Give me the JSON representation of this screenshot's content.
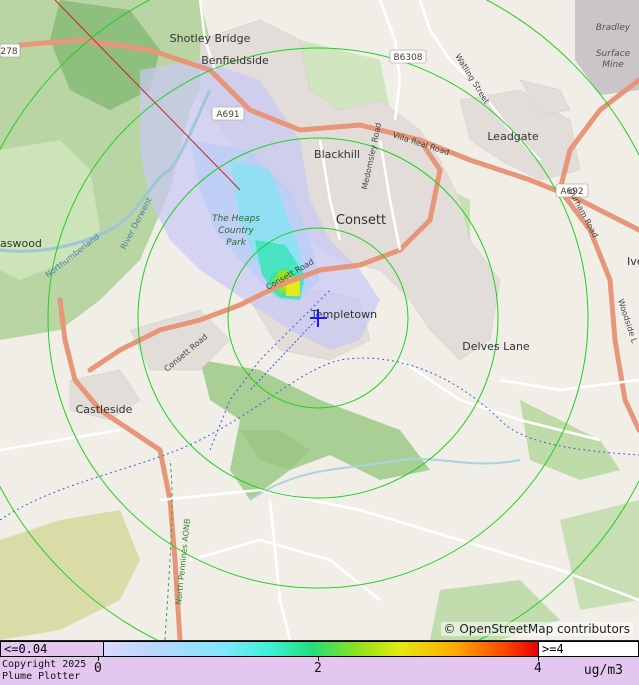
{
  "map": {
    "places": {
      "shotley_bridge": "Shotley Bridge",
      "benfieldside": "Benfieldside",
      "blackhill": "Blackhill",
      "consett": "Consett",
      "templetown": "Templetown",
      "delves_lane": "Delves Lane",
      "castleside": "Castleside",
      "leadgate": "Leadgate",
      "bradley_mine": [
        "Bradley",
        "Surface",
        "Mine"
      ],
      "iveston": "Ive",
      "laswood": "aswood",
      "heaps_park": [
        "The Heaps",
        "Country",
        "Park"
      ]
    },
    "roads": {
      "a691": "A691",
      "b6308": "B6308",
      "a692": "A692",
      "a68": "278",
      "villa_real_road": "Villa Real Road",
      "medomsley_road": "Medomsley Road",
      "consett_road": "Consett Road",
      "durham_road": "Durham Road",
      "watling_street": "Watling Street",
      "woodside": "Woodside L",
      "consett_road_2": "Consett Road"
    },
    "waterways": {
      "river_derwent": "River Derwent",
      "northumberland": "Northumberland"
    },
    "boundary_label": "North Pennines AONB",
    "attribution": "© OpenStreetMap contributors",
    "source_marker": "source-cross",
    "colors": {
      "ring": "#1ed11e",
      "cross": "#1a1aff",
      "road_major": "#e8967a",
      "road_minor": "#ffffff",
      "water": "#aad3df",
      "wood": "#add19e",
      "urban": "#e0dcd6"
    }
  },
  "legend": {
    "low_label": "<=0.04",
    "high_label": ">=4",
    "ticks": [
      "0",
      "2",
      "4"
    ],
    "units": "ug/m3",
    "copyright_line1": "Copyright 2025",
    "copyright_line2": "Plume Plotter"
  }
}
